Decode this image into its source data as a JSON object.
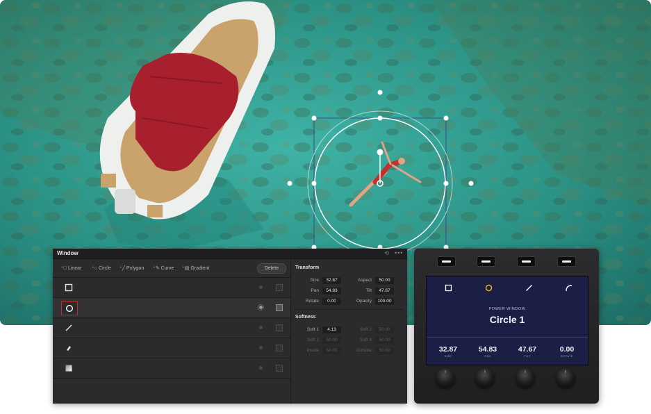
{
  "window_panel": {
    "title": "Window",
    "history_icon": "history-icon",
    "more_icon": "more-icon",
    "tools": [
      {
        "label": "Linear",
        "icon": "linear-icon"
      },
      {
        "label": "Circle",
        "icon": "circle-icon"
      },
      {
        "label": "Polygon",
        "icon": "polygon-icon"
      },
      {
        "label": "Curve",
        "icon": "curve-icon"
      },
      {
        "label": "Gradient",
        "icon": "gradient-icon"
      }
    ],
    "delete_label": "Delete",
    "windows": [
      {
        "shape": "square-window-icon",
        "selected": false
      },
      {
        "shape": "circle-window-icon",
        "selected": true
      },
      {
        "shape": "line-window-icon",
        "selected": false
      },
      {
        "shape": "pen-window-icon",
        "selected": false
      },
      {
        "shape": "gradient-window-icon",
        "selected": false
      }
    ],
    "transform": {
      "heading": "Transform",
      "size_label": "Size",
      "size": "32.87",
      "aspect_label": "Aspect",
      "aspect": "50.00",
      "pan_label": "Pan",
      "pan": "54.83",
      "tilt_label": "Tilt",
      "tilt": "47.67",
      "rotate_label": "Rotate",
      "rotate": "0.00",
      "opacity_label": "Opacity",
      "opacity": "100.00"
    },
    "softness": {
      "heading": "Softness",
      "soft1_label": "Soft 1",
      "soft1": "4.13",
      "soft2_label": "Soft 2",
      "soft2": "50.00",
      "soft3_label": "Soft 3",
      "soft3": "50.00",
      "soft4_label": "Soft 4",
      "soft4": "50.00",
      "inside_label": "Inside",
      "inside": "50.00",
      "outside_label": "Outside",
      "outside": "50.00"
    }
  },
  "hardware_panel": {
    "screen_subtitle": "POWER WINDOW",
    "screen_title": "Circle 1",
    "screen_icons": [
      "square-icon",
      "circle-icon",
      "line-icon",
      "curve-icon"
    ],
    "accent_color": "#e6b422",
    "readouts": [
      {
        "value": "32.87",
        "label": "SIZE"
      },
      {
        "value": "54.83",
        "label": "PAN"
      },
      {
        "value": "47.67",
        "label": "TILT"
      },
      {
        "value": "0.00",
        "label": "ROTATE"
      }
    ]
  },
  "colors": {
    "panel_bg": "#2b2b2d",
    "selection_border": "#c0312f",
    "screen_bg": "#1b1f45",
    "water": "#2f9a8c"
  }
}
